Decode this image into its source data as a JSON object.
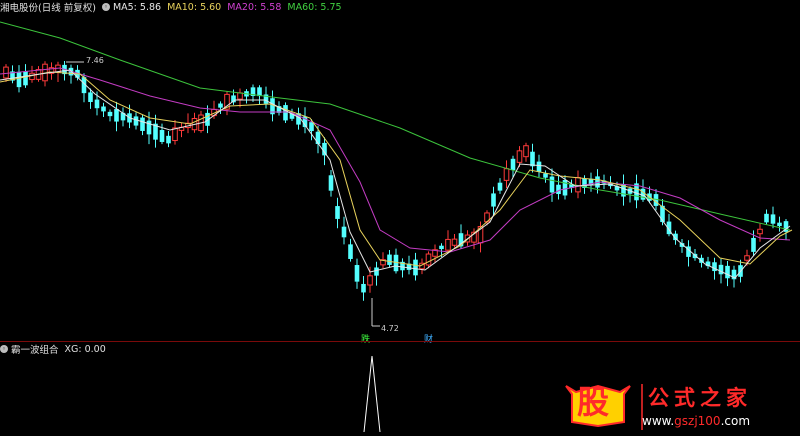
{
  "header": {
    "stock_title": "湘电股份(日线 前复权)",
    "ma5": "MA5: 5.86",
    "ma10": "MA10: 5.60",
    "ma20": "MA20: 5.58",
    "ma60": "MA60: 5.75"
  },
  "annotations": {
    "high_label": "7.46",
    "low_label": "4.72",
    "marker_die": "跌",
    "marker_cai": "财"
  },
  "indicator": {
    "title": "霸一波组合",
    "xg": "XG: 0.00"
  },
  "watermark": {
    "glyph": "股",
    "title": "公式之家",
    "url_prefix": "www.",
    "url_main": "gszj100",
    "url_suffix": ".com"
  },
  "colors": {
    "up": "#ff3b3b",
    "down": "#54ffff",
    "ma5": "#e6e6e6",
    "ma10": "#e8d25c",
    "ma20": "#c33cc3",
    "ma60": "#3cc33c",
    "indicator_line": "#ffffff"
  }
}
